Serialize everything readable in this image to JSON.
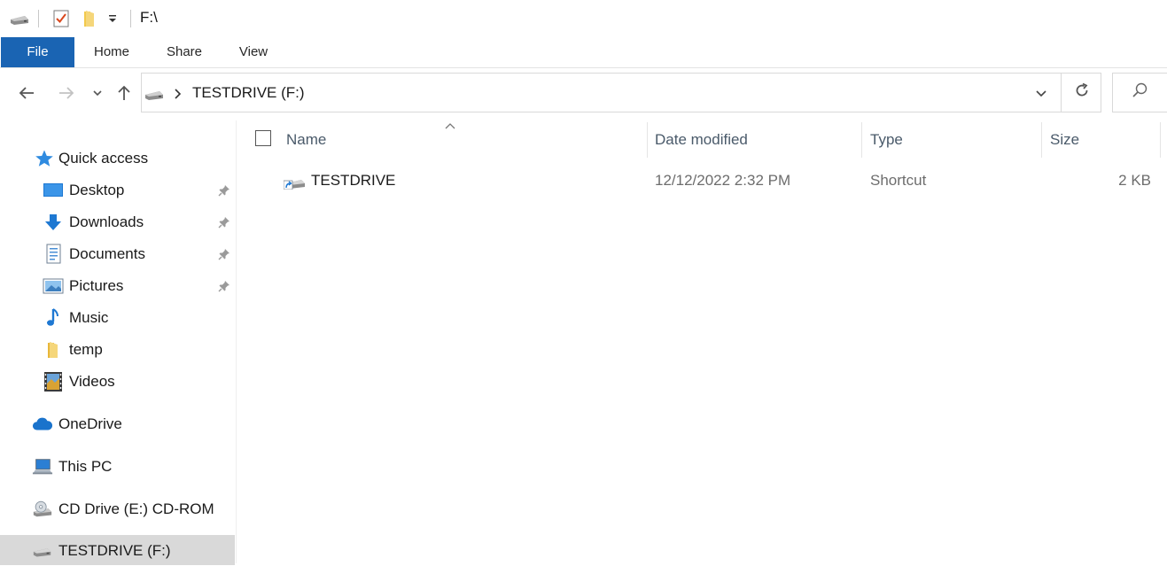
{
  "window": {
    "title": "F:\\"
  },
  "quick_access_toolbar": {
    "icons": [
      "drive-icon",
      "properties-check-icon",
      "new-folder-icon",
      "customize-dropdown-icon"
    ]
  },
  "ribbon": {
    "tabs": [
      {
        "label": "File",
        "active": true
      },
      {
        "label": "Home"
      },
      {
        "label": "Share"
      },
      {
        "label": "View"
      }
    ]
  },
  "navigation": {
    "back_icon": "arrow-left-icon",
    "forward_icon": "arrow-right-icon",
    "recent_icon": "chevron-down-icon",
    "up_icon": "arrow-up-icon"
  },
  "address_bar": {
    "breadcrumb": [
      {
        "label": "TESTDRIVE (F:)",
        "icon": "usb-drive-icon"
      }
    ],
    "dropdown_icon": "chevron-down-icon",
    "refresh_icon": "refresh-icon"
  },
  "search": {
    "icon": "search-icon",
    "placeholder": ""
  },
  "nav_pane": {
    "quick_access": {
      "label": "Quick access",
      "icon": "star-icon"
    },
    "pinned": [
      {
        "label": "Desktop",
        "icon": "desktop-icon",
        "pinned": true
      },
      {
        "label": "Downloads",
        "icon": "download-arrow-icon",
        "pinned": true
      },
      {
        "label": "Documents",
        "icon": "documents-icon",
        "pinned": true
      },
      {
        "label": "Pictures",
        "icon": "pictures-icon",
        "pinned": true
      },
      {
        "label": "Music",
        "icon": "music-note-icon",
        "pinned": false
      },
      {
        "label": "temp",
        "icon": "folder-icon",
        "pinned": false
      },
      {
        "label": "Videos",
        "icon": "videos-icon",
        "pinned": false
      }
    ],
    "onedrive": {
      "label": "OneDrive",
      "icon": "cloud-icon"
    },
    "this_pc": {
      "label": "This PC",
      "icon": "computer-icon"
    },
    "cd_drive": {
      "label": "CD Drive (E:) CD-ROM",
      "icon": "cd-drive-icon"
    },
    "testdrive": {
      "label": "TESTDRIVE (F:)",
      "icon": "usb-drive-icon",
      "selected": true
    }
  },
  "file_list": {
    "columns": {
      "name": "Name",
      "date_modified": "Date modified",
      "type": "Type",
      "size": "Size"
    },
    "sort_indicator": "sort-up-icon",
    "rows": [
      {
        "name": "TESTDRIVE",
        "date_modified": "12/12/2022 2:32 PM",
        "type": "Shortcut",
        "size": "2 KB",
        "icon": "shortcut-drive-icon"
      }
    ]
  },
  "colors": {
    "file_tab": "#1a64b3",
    "selection": "#d9d9d9",
    "accent_blue": "#1e78d2"
  }
}
